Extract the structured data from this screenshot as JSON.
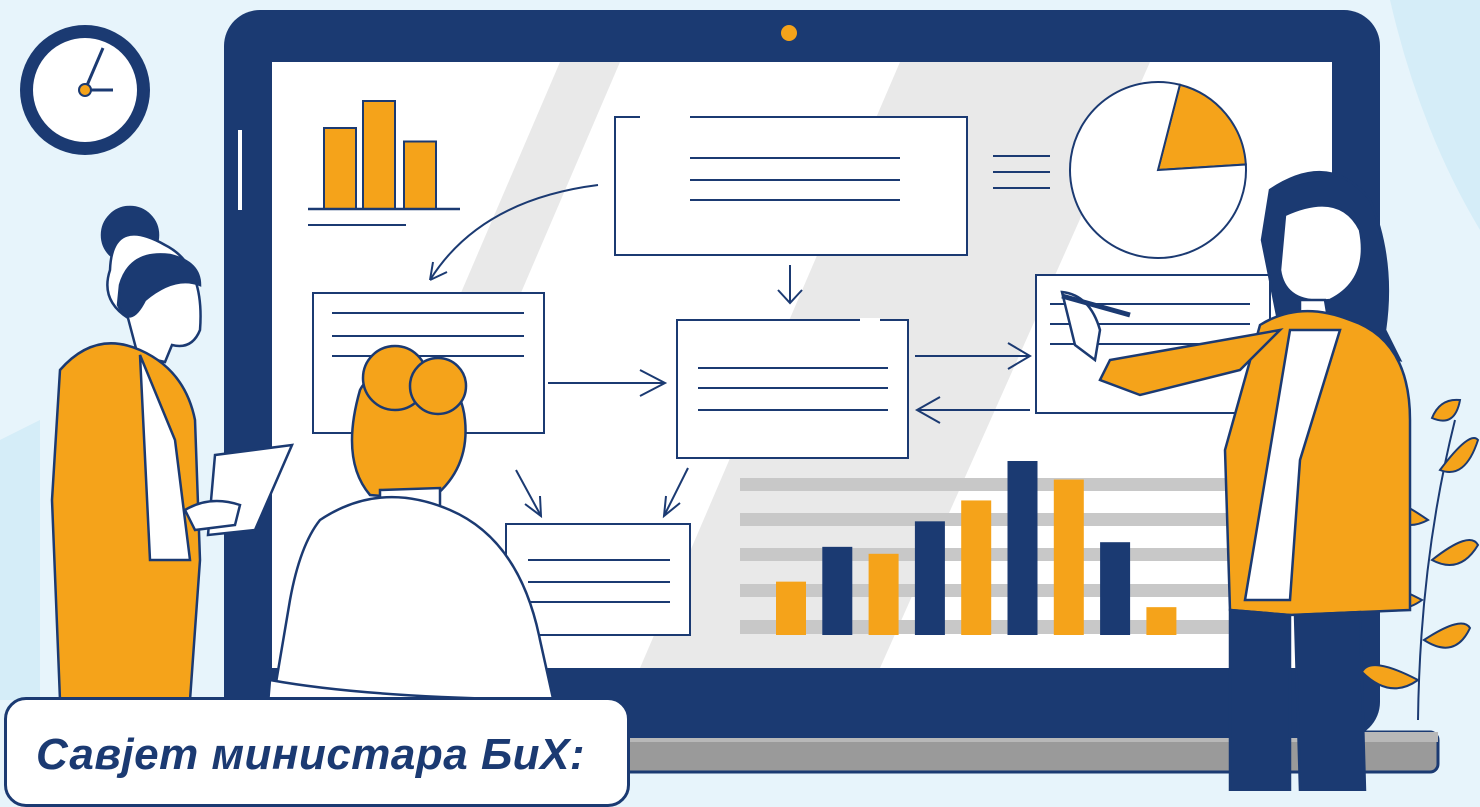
{
  "caption": {
    "text": "Савјет министара БиХ:"
  },
  "colors": {
    "navy": "#1b3a72",
    "orange": "#f5a31a",
    "background": "#e7f4fb",
    "screen": "#ffffff",
    "stripe": "#c8c8c8"
  },
  "icons": [
    "clock-icon",
    "plant-icon",
    "webcam-icon"
  ],
  "chart_data": [
    {
      "type": "bar",
      "values": [
        3,
        4,
        2.5
      ],
      "colors": [
        "#f5a31a",
        "#f5a31a",
        "#f5a31a"
      ]
    },
    {
      "type": "bar",
      "values": [
        2.3,
        3.8,
        3.5,
        4.9,
        5.8,
        7.5,
        6.7,
        4.0,
        1.2
      ],
      "colors": [
        "#f5a31a",
        "#1b3a72",
        "#f5a31a",
        "#1b3a72",
        "#f5a31a",
        "#1b3a72",
        "#f5a31a",
        "#1b3a72",
        "#f5a31a"
      ]
    },
    {
      "type": "pie",
      "values": [
        20,
        80
      ],
      "colors": [
        "#f5a31a",
        "#ffffff"
      ]
    }
  ]
}
